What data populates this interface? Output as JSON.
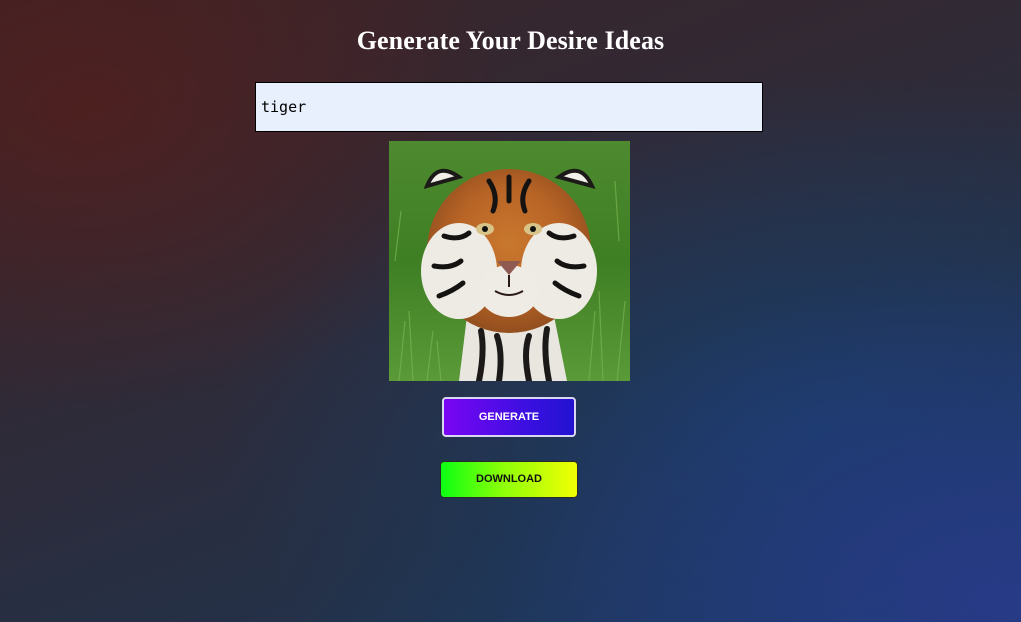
{
  "page": {
    "title": "Generate Your Desire Ideas"
  },
  "prompt": {
    "value": "tiger",
    "placeholder": ""
  },
  "result_image": {
    "subject": "tiger"
  },
  "buttons": {
    "generate_label": "GENERATE",
    "download_label": "DOWNLOAD"
  },
  "colors": {
    "input_bg": "#e8f0fe",
    "generate_gradient": [
      "#7a05f4",
      "#2212d0"
    ],
    "download_gradient": [
      "#0dff14",
      "#f2ff04"
    ]
  }
}
